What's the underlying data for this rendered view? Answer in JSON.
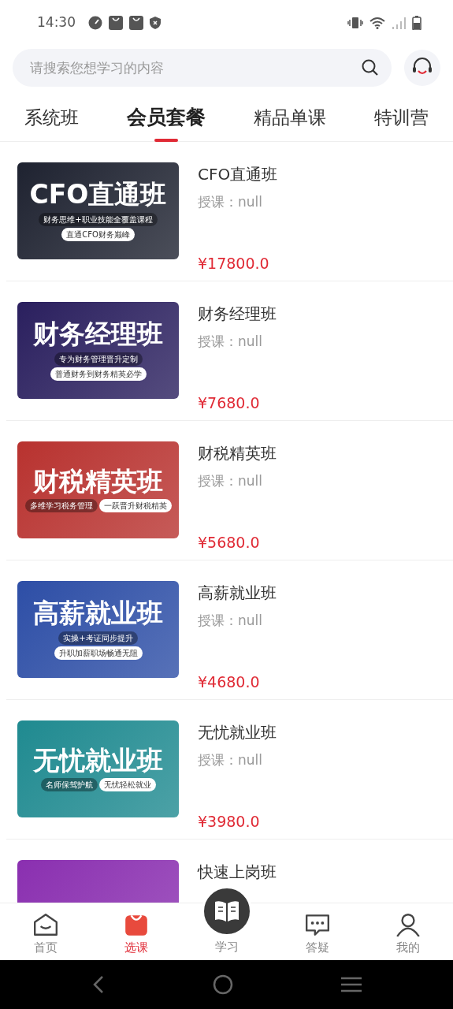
{
  "status_bar": {
    "time": "14:30"
  },
  "search": {
    "placeholder": "请搜索您想学习的内容"
  },
  "tabs": [
    {
      "label": "系统班",
      "selected": false
    },
    {
      "label": "会员套餐",
      "selected": true
    },
    {
      "label": "精品单课",
      "selected": false
    },
    {
      "label": "特训营",
      "selected": false
    }
  ],
  "courses": [
    {
      "title": "CFO直通班",
      "teacher": "授课：null",
      "price": "¥17800.0",
      "banner": {
        "color": "#1e2230",
        "heading": "CFO直通班",
        "tag_left": "财务思维+职业技能全覆盖课程",
        "tag_right": "直通CFO财务巅峰"
      }
    },
    {
      "title": "财务经理班",
      "teacher": "授课：null",
      "price": "¥7680.0",
      "banner": {
        "color": "#2a1f5e",
        "heading": "财务经理班",
        "tag_left": "专为财务管理晋升定制",
        "tag_right": "普通财务到财务精英必学"
      }
    },
    {
      "title": "财税精英班",
      "teacher": "授课：null",
      "price": "¥5680.0",
      "banner": {
        "color": "#b8322f",
        "heading": "财税精英班",
        "tag_left": "多维学习税务管理",
        "tag_right": "一跃晋升财税精英"
      }
    },
    {
      "title": "高薪就业班",
      "teacher": "授课：null",
      "price": "¥4680.0",
      "banner": {
        "color": "#2d4ea6",
        "heading": "高薪就业班",
        "tag_left": "实操+考证同步提升",
        "tag_right": "升职加薪职场畅通无阻"
      }
    },
    {
      "title": "无忧就业班",
      "teacher": "授课：null",
      "price": "¥3980.0",
      "banner": {
        "color": "#1f8a90",
        "heading": "无忧就业班",
        "tag_left": "名师保驾护航",
        "tag_right": "无忧轻松就业"
      }
    },
    {
      "title": "快速上岗班",
      "banner": {
        "color": "#8a2fb0"
      }
    }
  ],
  "nav": [
    {
      "label": "首页",
      "kind": "home",
      "selected": false
    },
    {
      "label": "选课",
      "kind": "bag",
      "selected": true
    },
    {
      "label": "学习",
      "kind": "book",
      "selected": false
    },
    {
      "label": "答疑",
      "kind": "chat",
      "selected": false
    },
    {
      "label": "我的",
      "kind": "person",
      "selected": false
    }
  ]
}
